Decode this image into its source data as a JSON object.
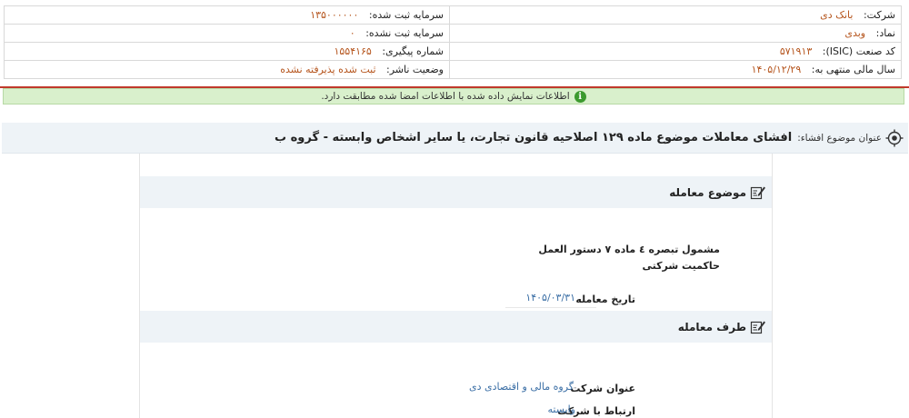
{
  "info": {
    "company_label": "شرکت:",
    "company_value": "بانک دی",
    "registered_capital_label": "سرمایه ثبت شده:",
    "registered_capital_value": "۱۳۵۰۰۰۰۰۰",
    "symbol_label": "نماد:",
    "symbol_value": "وبدی",
    "unregistered_capital_label": "سرمایه ثبت نشده:",
    "unregistered_capital_value": "۰",
    "isic_label": "کد صنعت (ISIC):",
    "isic_value": "۵۷۱۹۱۳",
    "tracking_label": "شماره پیگیری:",
    "tracking_value": "۱۵۵۴۱۶۵",
    "fiscal_year_label": "سال مالی منتهی به:",
    "fiscal_year_value": "۱۴۰۵/۱۲/۲۹",
    "publisher_status_label": "وضعیت ناشر:",
    "publisher_status_value": "ثبت شده پذیرفته نشده"
  },
  "alert": {
    "text": "اطلاعات نمایش داده شده با اطلاعات امضا شده مطابقت دارد.",
    "icon": "info-icon",
    "color": "#3c9a2e"
  },
  "subject": {
    "label": "عنوان موضوع افشاء:",
    "title": "افشای معاملات موضوع ماده ۱۲۹ اصلاحیه قانون تجارت، یا سایر اشخاص وابسته - گروه ب"
  },
  "transaction_subject": {
    "heading": "موضوع معامله",
    "description": "مشمول تبصره ٤ ماده ٧ دستور العمل حاكميت شركتی",
    "date_label": "تاریخ معامله",
    "date_value": "۱۴۰۵/۰۳/۳۱"
  },
  "counterparty": {
    "heading": "طرف معامله",
    "company_label": "عنوان شرکت",
    "company_value": "گروه مالی و اقتصادی دی",
    "relation_label": "ارتباط با شرکت",
    "relation_value": "وابسته"
  }
}
